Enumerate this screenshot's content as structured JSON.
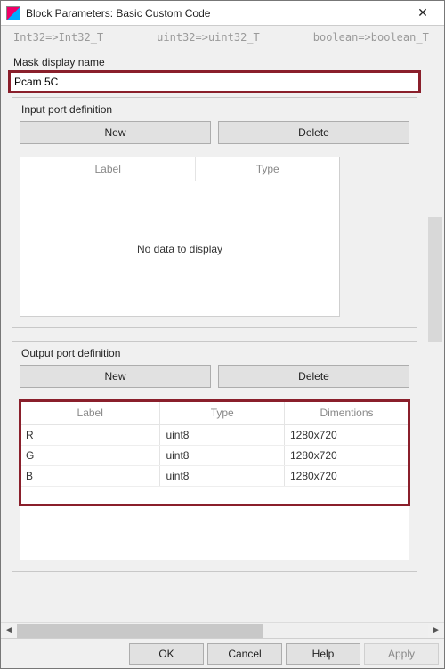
{
  "window": {
    "title": "Block Parameters: Basic Custom Code",
    "close_glyph": "✕"
  },
  "disabled_row": {
    "c1": "Int32=>Int32_T",
    "c2": "uint32=>uint32_T",
    "c3": "boolean=>boolean_T"
  },
  "mask": {
    "label": "Mask display name",
    "value": "Pcam 5C"
  },
  "input_ports": {
    "title": "Input port definition",
    "new_label": "New",
    "delete_label": "Delete",
    "columns": {
      "label": "Label",
      "type": "Type"
    },
    "empty_text": "No data to display"
  },
  "output_ports": {
    "title": "Output port definition",
    "new_label": "New",
    "delete_label": "Delete",
    "columns": {
      "label": "Label",
      "type": "Type",
      "dims": "Dimentions"
    },
    "rows": [
      {
        "label": "R",
        "type": "uint8",
        "dims": "1280x720"
      },
      {
        "label": "G",
        "type": "uint8",
        "dims": "1280x720"
      },
      {
        "label": "B",
        "type": "uint8",
        "dims": "1280x720"
      }
    ]
  },
  "footer": {
    "ok": "OK",
    "cancel": "Cancel",
    "help": "Help",
    "apply": "Apply"
  },
  "scroll": {
    "left_glyph": "◄",
    "right_glyph": "►"
  }
}
